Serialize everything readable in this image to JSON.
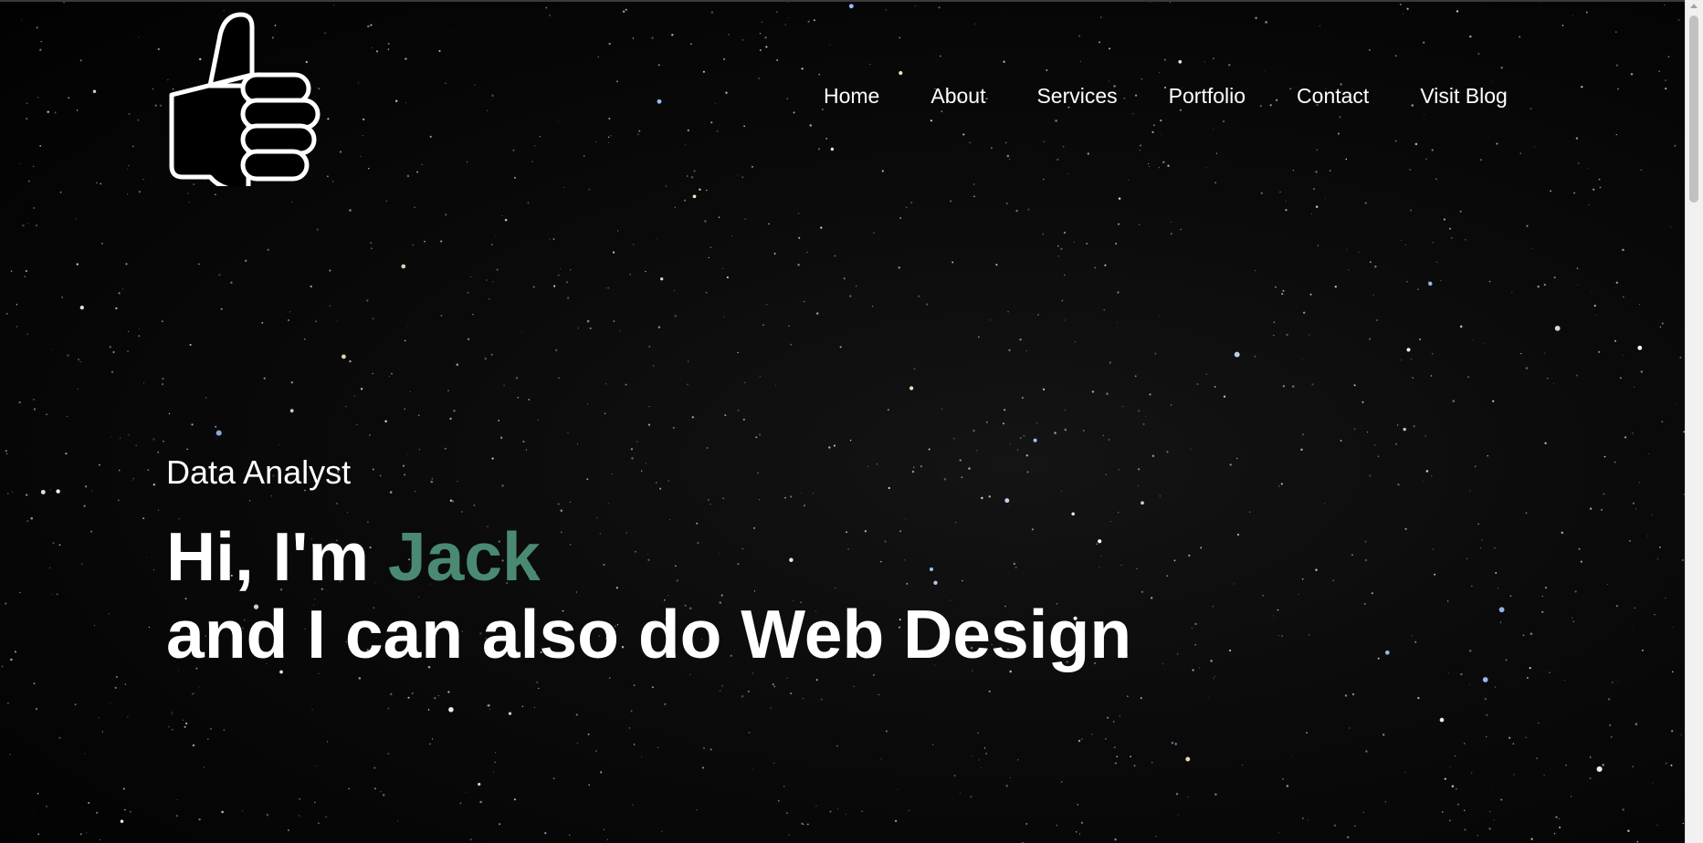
{
  "nav": {
    "items": [
      {
        "label": "Home"
      },
      {
        "label": "About"
      },
      {
        "label": "Services"
      },
      {
        "label": "Portfolio"
      },
      {
        "label": "Contact"
      },
      {
        "label": "Visit Blog"
      }
    ]
  },
  "hero": {
    "subtitle": "Data Analyst",
    "greeting": "Hi, I'm ",
    "name": "Jack",
    "tagline": "and I can also do Web Design"
  },
  "logo": {
    "icon": "thumbs-up-icon"
  },
  "colors": {
    "accent": "#4a8a72",
    "text": "#ffffff",
    "background": "#000000"
  }
}
